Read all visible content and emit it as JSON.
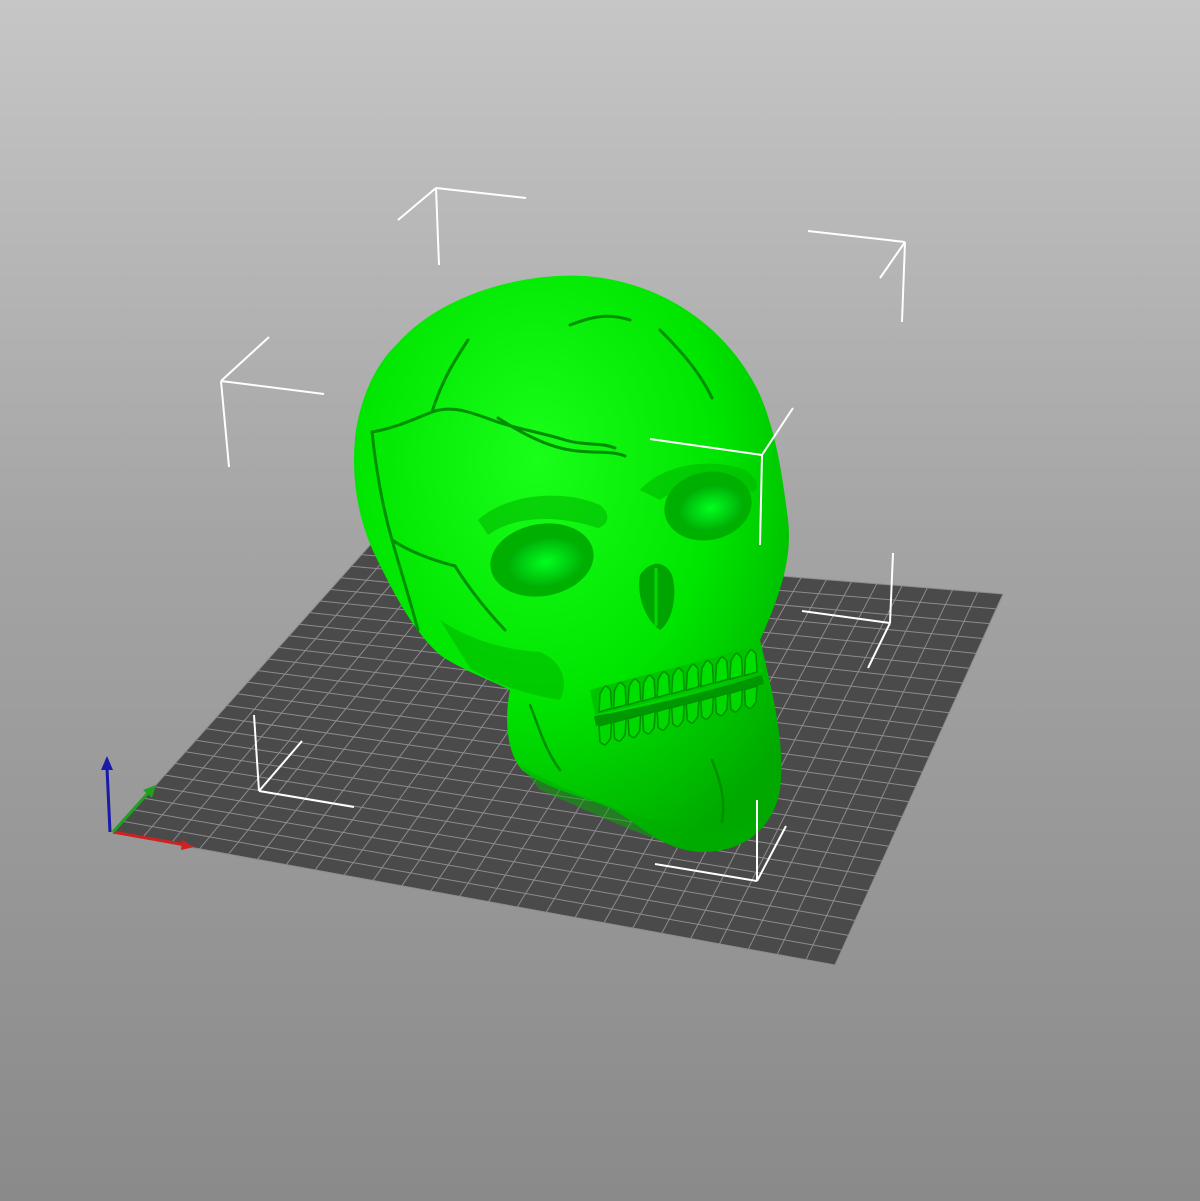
{
  "viewport": {
    "view": "3d-perspective",
    "background_top": "#c6c6c6",
    "background_bottom": "#8a8a8a"
  },
  "bed": {
    "surface_color": "#4a4a4a",
    "grid_color": "#8c8c8c",
    "grid_divisions": 25
  },
  "model": {
    "object": "skull",
    "color": "#00ee00",
    "selected": true
  },
  "selection_box": {
    "color": "#ffffff"
  },
  "axes": {
    "x_color": "#d02020",
    "y_color": "#20a020",
    "z_color": "#1a1aa8"
  }
}
